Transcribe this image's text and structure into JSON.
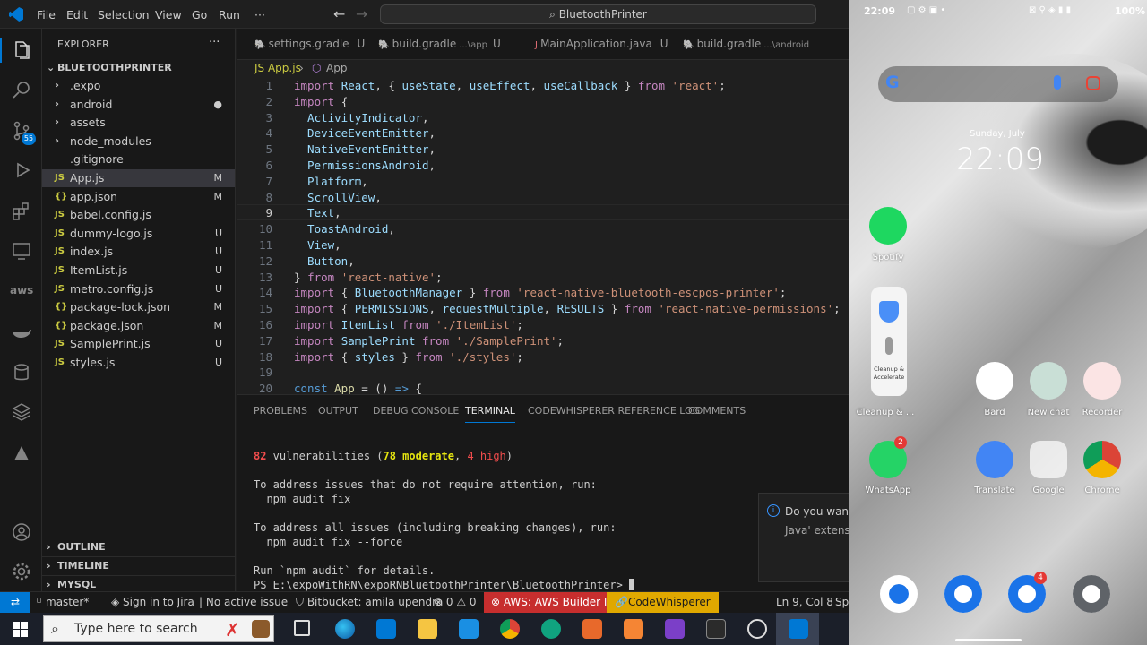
{
  "titlebar": {
    "menus": [
      "File",
      "Edit",
      "Selection",
      "View",
      "Go",
      "Run",
      "···"
    ],
    "search": "BluetoothPrinter"
  },
  "explorer": {
    "title": "EXPLORER",
    "more": "···",
    "root": "BLUETOOTHPRINTER",
    "items": [
      {
        "icon": "›",
        "name": ".expo",
        "badge": ""
      },
      {
        "icon": "›",
        "name": "android",
        "badge": "●"
      },
      {
        "icon": "›",
        "name": "assets",
        "badge": ""
      },
      {
        "icon": "›",
        "name": "node_modules",
        "badge": ""
      },
      {
        "icon": "",
        "name": ".gitignore",
        "badge": ""
      },
      {
        "icon": "JS",
        "name": "App.js",
        "badge": "M"
      },
      {
        "icon": "{}",
        "name": "app.json",
        "badge": "M"
      },
      {
        "icon": "JS",
        "name": "babel.config.js",
        "badge": ""
      },
      {
        "icon": "JS",
        "name": "dummy-logo.js",
        "badge": "U"
      },
      {
        "icon": "JS",
        "name": "index.js",
        "badge": "U"
      },
      {
        "icon": "JS",
        "name": "ItemList.js",
        "badge": "U"
      },
      {
        "icon": "JS",
        "name": "metro.config.js",
        "badge": "U"
      },
      {
        "icon": "{}",
        "name": "package-lock.json",
        "badge": "M"
      },
      {
        "icon": "{}",
        "name": "package.json",
        "badge": "M"
      },
      {
        "icon": "JS",
        "name": "SamplePrint.js",
        "badge": "U"
      },
      {
        "icon": "JS",
        "name": "styles.js",
        "badge": "U"
      }
    ],
    "sections": [
      "OUTLINE",
      "TIMELINE",
      "MYSQL"
    ]
  },
  "tabs": [
    {
      "label": "settings.gradle",
      "suffix": "",
      "badge": "U"
    },
    {
      "label": "build.gradle",
      "suffix": "...\\app",
      "badge": "U"
    },
    {
      "label": "MainApplication.java",
      "suffix": "",
      "badge": "U"
    },
    {
      "label": "build.gradle",
      "suffix": "...\\android",
      "badge": ""
    }
  ],
  "breadcrumbs": {
    "file": "JS App.js",
    "sep": "›",
    "symbol": "App"
  },
  "editor": {
    "line_numbers": [
      "1",
      "2",
      "3",
      "4",
      "5",
      "6",
      "7",
      "8",
      "9",
      "10",
      "11",
      "12",
      "13",
      "14",
      "15",
      "16",
      "17",
      "18",
      "19",
      "20"
    ],
    "lines": [
      [
        [
          "kw2",
          "import "
        ],
        [
          "id",
          "React"
        ],
        [
          "pun",
          ", { "
        ],
        [
          "id",
          "useState"
        ],
        [
          "pun",
          ", "
        ],
        [
          "id",
          "useEffect"
        ],
        [
          "pun",
          ", "
        ],
        [
          "id",
          "useCallback"
        ],
        [
          "pun",
          " } "
        ],
        [
          "kw2",
          "from "
        ],
        [
          "str",
          "'react'"
        ],
        [
          "pun",
          ";"
        ]
      ],
      [
        [
          "kw2",
          "import "
        ],
        [
          "pun",
          "{"
        ]
      ],
      [
        [
          "id",
          "  ActivityIndicator"
        ],
        [
          "pun",
          ","
        ]
      ],
      [
        [
          "id",
          "  DeviceEventEmitter"
        ],
        [
          "pun",
          ","
        ]
      ],
      [
        [
          "id",
          "  NativeEventEmitter"
        ],
        [
          "pun",
          ","
        ]
      ],
      [
        [
          "id",
          "  PermissionsAndroid"
        ],
        [
          "pun",
          ","
        ]
      ],
      [
        [
          "id",
          "  Platform"
        ],
        [
          "pun",
          ","
        ]
      ],
      [
        [
          "id",
          "  ScrollView"
        ],
        [
          "pun",
          ","
        ]
      ],
      [
        [
          "id",
          "  Text"
        ],
        [
          "pun",
          ","
        ]
      ],
      [
        [
          "id",
          "  ToastAndroid"
        ],
        [
          "pun",
          ","
        ]
      ],
      [
        [
          "id",
          "  View"
        ],
        [
          "pun",
          ","
        ]
      ],
      [
        [
          "id",
          "  Button"
        ],
        [
          "pun",
          ","
        ]
      ],
      [
        [
          "pun",
          "} "
        ],
        [
          "kw2",
          "from "
        ],
        [
          "str",
          "'react-native'"
        ],
        [
          "pun",
          ";"
        ]
      ],
      [
        [
          "kw2",
          "import "
        ],
        [
          "pun",
          "{ "
        ],
        [
          "id",
          "BluetoothManager"
        ],
        [
          "pun",
          " } "
        ],
        [
          "kw2",
          "from "
        ],
        [
          "str",
          "'react-native-bluetooth-escpos-printer'"
        ],
        [
          "pun",
          ";"
        ]
      ],
      [
        [
          "kw2",
          "import "
        ],
        [
          "pun",
          "{ "
        ],
        [
          "id",
          "PERMISSIONS"
        ],
        [
          "pun",
          ", "
        ],
        [
          "id",
          "requestMultiple"
        ],
        [
          "pun",
          ", "
        ],
        [
          "id",
          "RESULTS"
        ],
        [
          "pun",
          " } "
        ],
        [
          "kw2",
          "from "
        ],
        [
          "str",
          "'react-native-permissions'"
        ],
        [
          "pun",
          ";"
        ]
      ],
      [
        [
          "kw2",
          "import "
        ],
        [
          "id",
          "ItemList "
        ],
        [
          "kw2",
          "from "
        ],
        [
          "str",
          "'./ItemList'"
        ],
        [
          "pun",
          ";"
        ]
      ],
      [
        [
          "kw2",
          "import "
        ],
        [
          "id",
          "SamplePrint "
        ],
        [
          "kw2",
          "from "
        ],
        [
          "str",
          "'./SamplePrint'"
        ],
        [
          "pun",
          ";"
        ]
      ],
      [
        [
          "kw2",
          "import "
        ],
        [
          "pun",
          "{ "
        ],
        [
          "id",
          "styles"
        ],
        [
          "pun",
          " } "
        ],
        [
          "kw2",
          "from "
        ],
        [
          "str",
          "'./styles'"
        ],
        [
          "pun",
          ";"
        ]
      ],
      [],
      [
        [
          "kw",
          "const "
        ],
        [
          "fn",
          "App"
        ],
        [
          "pun",
          " = () "
        ],
        [
          "kw",
          "=>"
        ],
        [
          "pun",
          " {"
        ]
      ]
    ]
  },
  "panel": {
    "tabs": [
      "PROBLEMS",
      "OUTPUT",
      "DEBUG CONSOLE",
      "TERMINAL",
      "CODEWHISPERER REFERENCE LOG",
      "COMMENTS"
    ],
    "active_tab": "TERMINAL",
    "terminal": {
      "vuln_count": "82",
      "vuln_text": " vulnerabilities (",
      "moderate": "78 moderate",
      "sep": ", ",
      "high": "4 high",
      "close": ")",
      "line2": "To address issues that do not require attention, run:",
      "line3": "  npm audit fix",
      "line4": "To address all issues (including breaking changes), run:",
      "line5": "  npm audit fix --force",
      "line6": "Run `npm audit` for details.",
      "prompt": "PS E:\\expoWithRN\\expoRNBluetoothPrinter\\BluetoothPrinter> "
    }
  },
  "notification": {
    "line1": "Do you want",
    "line2": "Java' extensio"
  },
  "statusbar": {
    "remote": "⇄",
    "branch": "master*",
    "jira": "Sign in to Jira",
    "issue": "No active issue",
    "bitbucket": "Bitbucket: amila upendra",
    "errors": "⊗ 0 ⚠ 0",
    "aws": "AWS: AWS Builder ID",
    "codewhisperer": "CodeWhisperer",
    "position": "Ln 9, Col 8",
    "spaces": "Spa"
  },
  "taskbar": {
    "search_placeholder": "Type here to search"
  },
  "phone": {
    "status_time": "22:09",
    "battery": "100%",
    "date": "Sunday, July",
    "clock": "22:09",
    "apps": [
      {
        "label": "Spotify"
      },
      {
        "label": "Cleanup & ..."
      },
      {
        "label": "Bard"
      },
      {
        "label": "New chat"
      },
      {
        "label": "Recorder"
      },
      {
        "label": "WhatsApp",
        "badge": "2"
      },
      {
        "label": "Translate"
      },
      {
        "label": "Google"
      },
      {
        "label": "Chrome"
      }
    ],
    "widget": {
      "label": "Cleanup & Accelerate"
    },
    "dock_badge": "4",
    "colors": {
      "spotify": "#1ed760",
      "whatsapp": "#25d366",
      "chrome": "#db4437",
      "phone": "#1a73e8"
    }
  },
  "colors": {
    "accent": "#0078d4",
    "aws": "#c72e2e",
    "codewhisperer": "#e0a800"
  }
}
